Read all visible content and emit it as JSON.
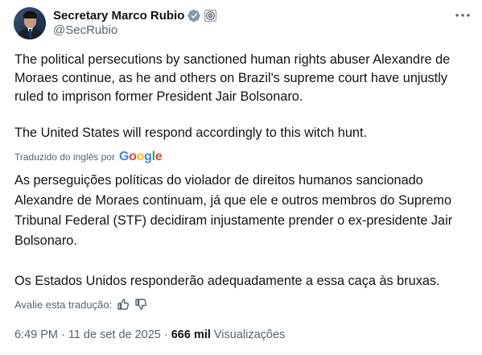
{
  "author": {
    "display_name": "Secretary Marco Rubio",
    "handle": "@SecRubio"
  },
  "post": {
    "paragraphs": [
      "The political persecutions by sanctioned human rights abuser Alexandre de Moraes continue, as he and others on Brazil's supreme court have unjustly ruled to imprison former President Jair Bolsonaro.",
      "The United States will respond accordingly to this witch hunt."
    ]
  },
  "translation": {
    "label": "Traduzido do inglês por",
    "provider": "Google",
    "paragraphs": [
      "As perseguições políticas do violador de direitos humanos sancionado Alexandre de Moraes continuam, já que ele e outros membros do Supremo Tribunal Federal (STF) decidiram injustamente prender o ex-presidente Jair Bolsonaro.",
      "Os Estados Unidos responderão adequadamente a essa caça às bruxas."
    ],
    "rate_label": "Avalie esta tradução:"
  },
  "meta": {
    "time": "6:49 PM",
    "separator": "·",
    "date": "11 de set de 2025",
    "views_count": "666 mil",
    "views_label": "Visualizações"
  },
  "colors": {
    "text": "#0f1419",
    "secondary": "#536471",
    "verified_badge": "#829aab"
  },
  "icons": {
    "verified": "verified-badge-icon",
    "affiliation": "us-state-department-seal-icon",
    "more": "more-options-icon",
    "thumbs_up": "thumbs-up-icon",
    "thumbs_down": "thumbs-down-icon"
  }
}
